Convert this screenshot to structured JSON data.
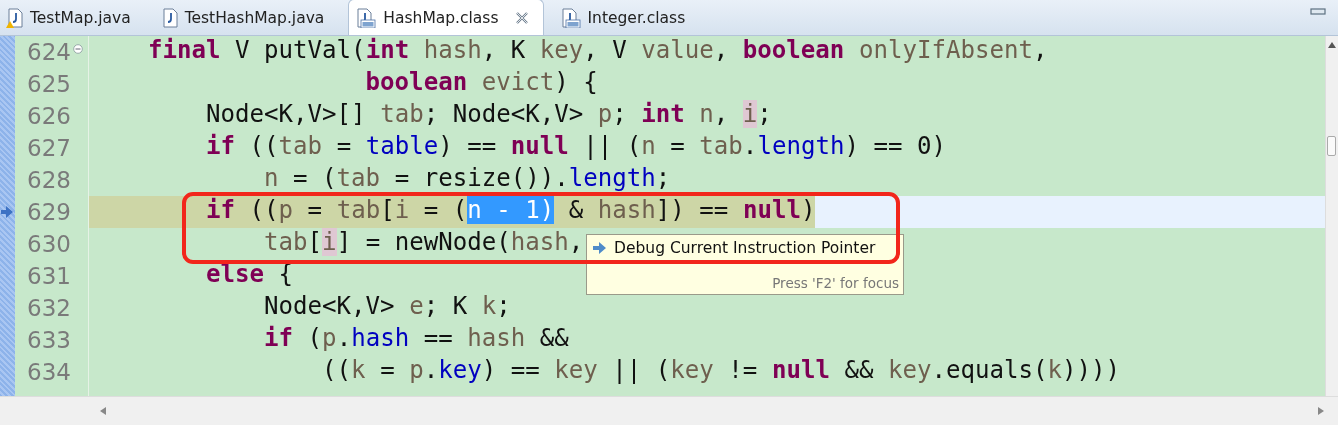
{
  "tabs": [
    {
      "label": "TestMap.java",
      "kind": "source",
      "warning": true,
      "selected": false
    },
    {
      "label": "TestHashMap.java",
      "kind": "source",
      "warning": false,
      "selected": false
    },
    {
      "label": "HashMap.class",
      "kind": "binary",
      "warning": false,
      "selected": true
    },
    {
      "label": "Integer.class",
      "kind": "binary",
      "warning": false,
      "selected": false
    }
  ],
  "editor": {
    "lines": [
      {
        "number": "624",
        "expanded": true,
        "current": false,
        "tokens": [
          {
            "text": "    final",
            "kind": "keyword"
          },
          {
            "text": " V putVal(",
            "kind": "plain"
          },
          {
            "text": "int ",
            "kind": "keyword"
          },
          {
            "text": "hash",
            "kind": "variable"
          },
          {
            "text": ", K ",
            "kind": "plain"
          },
          {
            "text": "key",
            "kind": "variable"
          },
          {
            "text": ", V ",
            "kind": "plain"
          },
          {
            "text": "value",
            "kind": "variable"
          },
          {
            "text": ", ",
            "kind": "plain"
          },
          {
            "text": "boolean ",
            "kind": "keyword"
          },
          {
            "text": "onlyIfAbsent",
            "kind": "variable"
          },
          {
            "text": ",",
            "kind": "plain"
          }
        ]
      },
      {
        "number": "625",
        "current": false,
        "tokens": [
          {
            "text": "                   boolean ",
            "kind": "keyword"
          },
          {
            "text": "evict",
            "kind": "variable"
          },
          {
            "text": ") {",
            "kind": "plain"
          }
        ]
      },
      {
        "number": "626",
        "current": false,
        "tokens": [
          {
            "text": "        Node<K,V>[] ",
            "kind": "plain"
          },
          {
            "text": "tab",
            "kind": "variable"
          },
          {
            "text": "; Node<K,V> ",
            "kind": "plain"
          },
          {
            "text": "p",
            "kind": "variable"
          },
          {
            "text": "; ",
            "kind": "plain"
          },
          {
            "text": "int ",
            "kind": "keyword"
          },
          {
            "text": "n",
            "kind": "variable"
          },
          {
            "text": ", ",
            "kind": "plain"
          },
          {
            "text": "i",
            "kind": "occurrence"
          },
          {
            "text": ";",
            "kind": "plain"
          }
        ]
      },
      {
        "number": "627",
        "current": false,
        "tokens": [
          {
            "text": "        if",
            "kind": "keyword"
          },
          {
            "text": " ((",
            "kind": "plain"
          },
          {
            "text": "tab",
            "kind": "variable"
          },
          {
            "text": " = ",
            "kind": "plain"
          },
          {
            "text": "table",
            "kind": "field"
          },
          {
            "text": ") == ",
            "kind": "plain"
          },
          {
            "text": "null",
            "kind": "keyword"
          },
          {
            "text": " || (",
            "kind": "plain"
          },
          {
            "text": "n",
            "kind": "variable"
          },
          {
            "text": " = ",
            "kind": "plain"
          },
          {
            "text": "tab",
            "kind": "variable"
          },
          {
            "text": ".",
            "kind": "plain"
          },
          {
            "text": "length",
            "kind": "field"
          },
          {
            "text": ") == 0)",
            "kind": "plain"
          }
        ]
      },
      {
        "number": "628",
        "current": false,
        "tokens": [
          {
            "text": "            n",
            "kind": "variable"
          },
          {
            "text": " = (",
            "kind": "plain"
          },
          {
            "text": "tab",
            "kind": "variable"
          },
          {
            "text": " = resize()).",
            "kind": "plain"
          },
          {
            "text": "length",
            "kind": "field"
          },
          {
            "text": ";",
            "kind": "plain"
          }
        ]
      },
      {
        "number": "629",
        "current": true,
        "tokens": [
          {
            "text": "        if",
            "kind": "keyword"
          },
          {
            "text": " ((",
            "kind": "plain"
          },
          {
            "text": "p",
            "kind": "variable"
          },
          {
            "text": " = ",
            "kind": "plain"
          },
          {
            "text": "tab",
            "kind": "variable"
          },
          {
            "text": "[",
            "kind": "plain"
          },
          {
            "text": "i",
            "kind": "variable"
          },
          {
            "text": " = (",
            "kind": "plain"
          },
          {
            "text": "n - 1)",
            "kind": "selection"
          },
          {
            "text": " & ",
            "kind": "plain"
          },
          {
            "text": "hash",
            "kind": "variable"
          },
          {
            "text": "]) == ",
            "kind": "plain"
          },
          {
            "text": "null",
            "kind": "keyword"
          },
          {
            "text": ")",
            "kind": "plain"
          }
        ]
      },
      {
        "number": "630",
        "current": false,
        "tokens": [
          {
            "text": "            tab",
            "kind": "variable"
          },
          {
            "text": "[",
            "kind": "plain"
          },
          {
            "text": "i",
            "kind": "occurrence"
          },
          {
            "text": "] = newNode(",
            "kind": "plain"
          },
          {
            "text": "hash",
            "kind": "variable"
          },
          {
            "text": ",",
            "kind": "plain"
          }
        ]
      },
      {
        "number": "631",
        "current": false,
        "tokens": [
          {
            "text": "        else",
            "kind": "keyword"
          },
          {
            "text": " {",
            "kind": "plain"
          }
        ]
      },
      {
        "number": "632",
        "current": false,
        "tokens": [
          {
            "text": "            Node<K,V> ",
            "kind": "plain"
          },
          {
            "text": "e",
            "kind": "variable"
          },
          {
            "text": "; K ",
            "kind": "plain"
          },
          {
            "text": "k",
            "kind": "variable"
          },
          {
            "text": ";",
            "kind": "plain"
          }
        ]
      },
      {
        "number": "633",
        "current": false,
        "tokens": [
          {
            "text": "            if",
            "kind": "keyword"
          },
          {
            "text": " (",
            "kind": "plain"
          },
          {
            "text": "p",
            "kind": "variable"
          },
          {
            "text": ".",
            "kind": "plain"
          },
          {
            "text": "hash",
            "kind": "field"
          },
          {
            "text": " == ",
            "kind": "plain"
          },
          {
            "text": "hash",
            "kind": "variable"
          },
          {
            "text": " &&",
            "kind": "plain"
          }
        ]
      },
      {
        "number": "634",
        "current": false,
        "tokens": [
          {
            "text": "                ((",
            "kind": "plain"
          },
          {
            "text": "k",
            "kind": "variable"
          },
          {
            "text": " = ",
            "kind": "plain"
          },
          {
            "text": "p",
            "kind": "variable"
          },
          {
            "text": ".",
            "kind": "plain"
          },
          {
            "text": "key",
            "kind": "field"
          },
          {
            "text": ") == ",
            "kind": "plain"
          },
          {
            "text": "key",
            "kind": "variable"
          },
          {
            "text": " || (",
            "kind": "plain"
          },
          {
            "text": "key",
            "kind": "variable"
          },
          {
            "text": " != ",
            "kind": "plain"
          },
          {
            "text": "null",
            "kind": "keyword"
          },
          {
            "text": " && ",
            "kind": "plain"
          },
          {
            "text": "key",
            "kind": "variable"
          },
          {
            "text": ".equals(",
            "kind": "plain"
          },
          {
            "text": "k",
            "kind": "variable"
          },
          {
            "text": "))))",
            "kind": "plain"
          }
        ]
      }
    ]
  },
  "tooltip": {
    "title": "Debug Current Instruction Pointer",
    "footer": "Press 'F2' for focus"
  }
}
